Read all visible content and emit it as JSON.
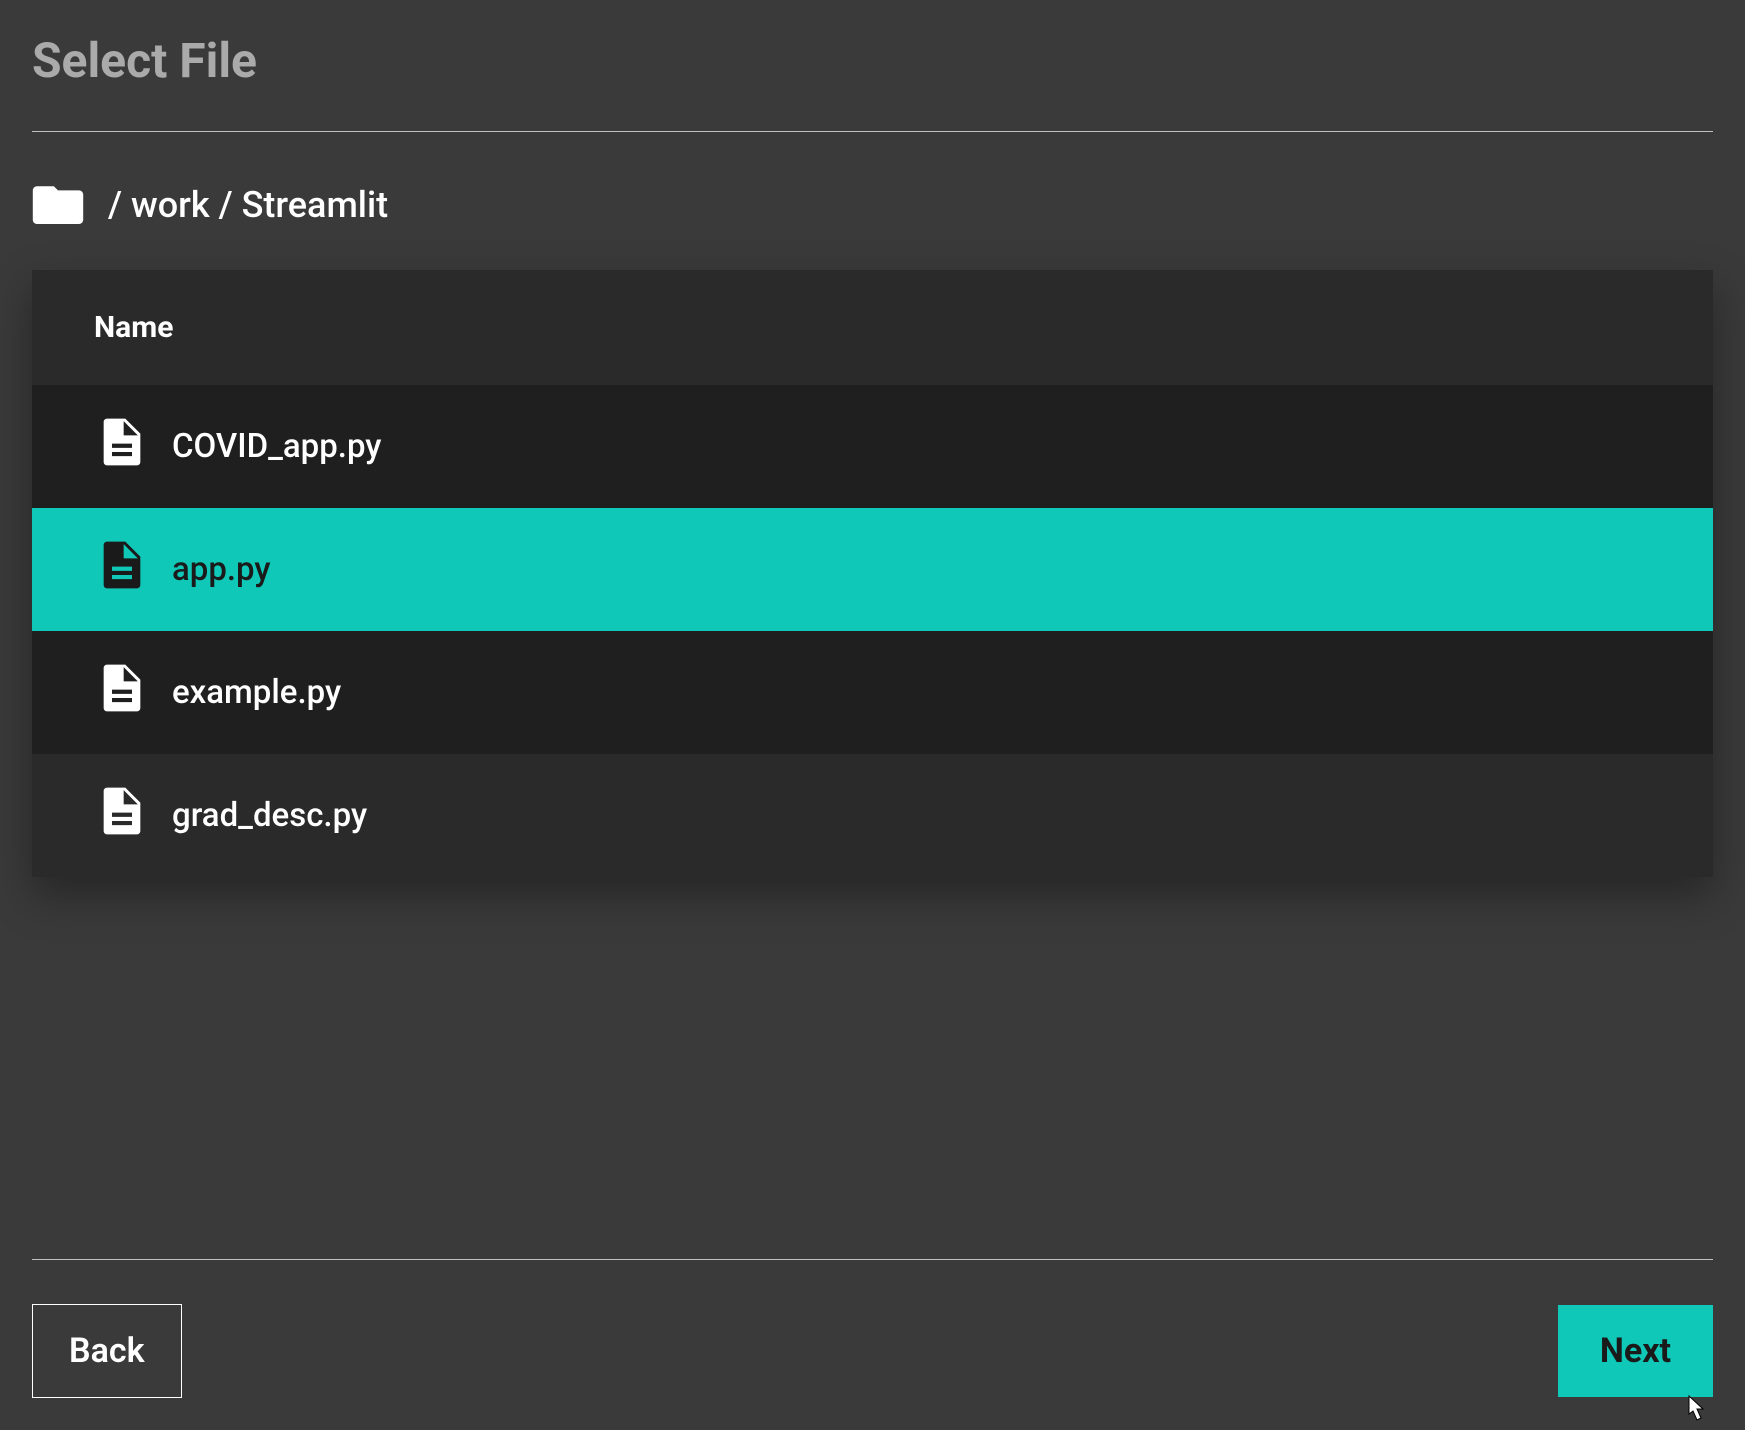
{
  "title": "Select File",
  "breadcrumb": {
    "path": " / work / Streamlit"
  },
  "table": {
    "header_label": "Name",
    "rows": [
      {
        "name": "COVID_app.py",
        "selected": false
      },
      {
        "name": "app.py",
        "selected": true
      },
      {
        "name": "example.py",
        "selected": false
      },
      {
        "name": "grad_desc.py",
        "selected": false
      }
    ]
  },
  "buttons": {
    "back": "Back",
    "next": "Next"
  },
  "colors": {
    "accent": "#10c8b8",
    "bg": "#3a3a3a",
    "row_dark": "#1f1f1f",
    "row_med": "#2a2a2a"
  }
}
